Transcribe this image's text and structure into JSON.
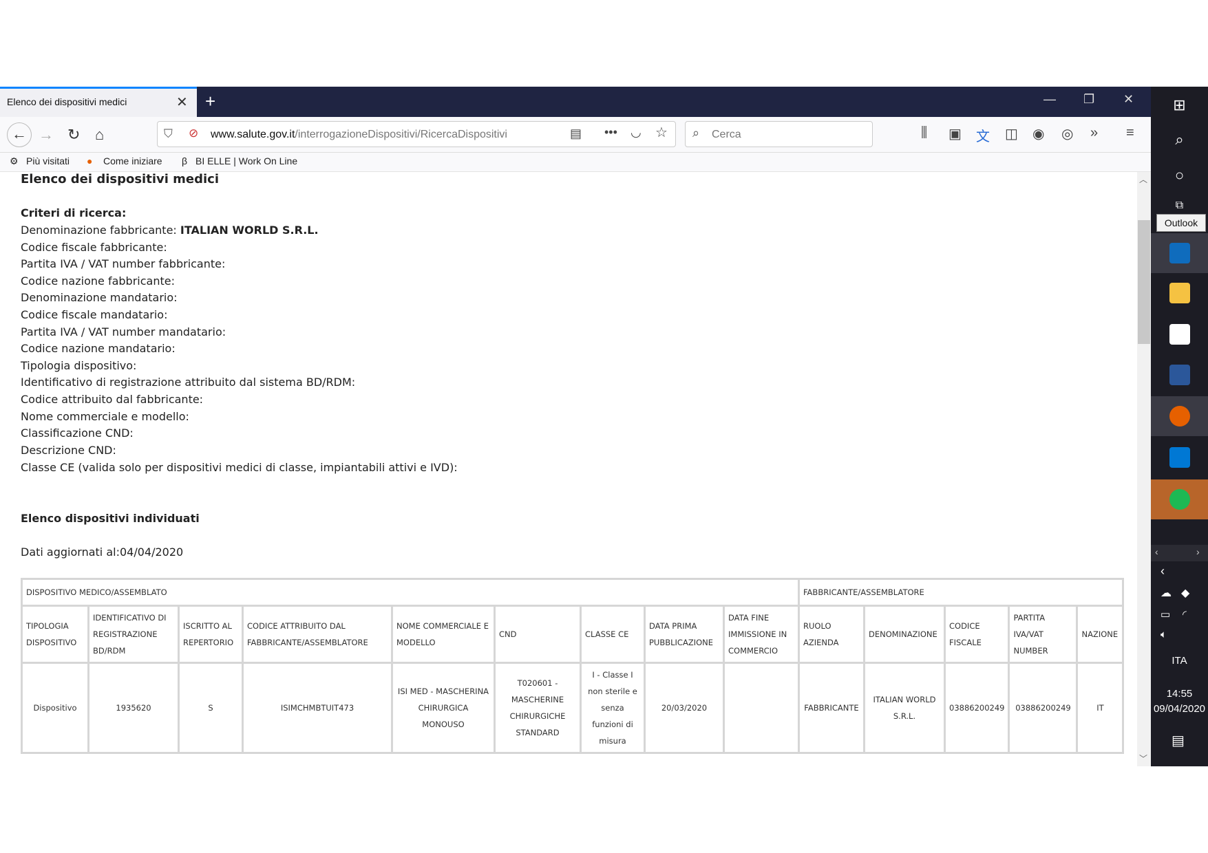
{
  "browser": {
    "tab_title": "Elenco dei dispositivi medici",
    "tab_close": "✕",
    "new_tab": "+",
    "url_domain": "www.salute.gov.it",
    "url_path": "/interrogazioneDispositivi/RicercaDispositivi",
    "search_placeholder": "Cerca",
    "bookmarks": [
      "Più visitati",
      "Come iniziare",
      "BI ELLE | Work On Line"
    ]
  },
  "page": {
    "title": "Elenco dei dispositivi medici",
    "criteria_title": "Criteri di ricerca:",
    "criteria": [
      {
        "label": "Denominazione fabbricante:",
        "value": "ITALIAN WORLD S.R.L."
      },
      {
        "label": "Codice fiscale fabbricante:",
        "value": ""
      },
      {
        "label": "Partita IVA / VAT number fabbricante:",
        "value": ""
      },
      {
        "label": "Codice nazione fabbricante:",
        "value": ""
      },
      {
        "label": "Denominazione mandatario:",
        "value": ""
      },
      {
        "label": "Codice fiscale mandatario:",
        "value": ""
      },
      {
        "label": "Partita IVA / VAT number mandatario:",
        "value": ""
      },
      {
        "label": "Codice nazione mandatario:",
        "value": ""
      },
      {
        "label": "Tipologia dispositivo:",
        "value": ""
      },
      {
        "label": "Identificativo di registrazione attribuito dal sistema BD/RDM:",
        "value": ""
      },
      {
        "label": "Codice attribuito dal fabbricante:",
        "value": ""
      },
      {
        "label": "Nome commerciale e modello:",
        "value": ""
      },
      {
        "label": "Classificazione CND:",
        "value": ""
      },
      {
        "label": "Descrizione CND:",
        "value": ""
      },
      {
        "label": "Classe CE (valida solo per dispositivi medici di classe, impiantabili attivi e IVD):",
        "value": ""
      }
    ],
    "found_title": "Elenco dispositivi individuati",
    "updated": "Dati aggiornati al:04/04/2020"
  },
  "table": {
    "group_headers": [
      "DISPOSITIVO MEDICO/ASSEMBLATO",
      "FABBRICANTE/ASSEMBLATORE"
    ],
    "columns": [
      "TIPOLOGIA DISPOSITIVO",
      "IDENTIFICATIVO DI REGISTRAZIONE BD/RDM",
      "ISCRITTO AL REPERTORIO",
      "CODICE ATTRIBUITO DAL FABBRICANTE/ASSEMBLATORE",
      "NOME COMMERCIALE E MODELLO",
      "CND",
      "CLASSE CE",
      "DATA PRIMA PUBBLICAZIONE",
      "DATA FINE IMMISSIONE IN COMMERCIO",
      "RUOLO AZIENDA",
      "DENOMINAZIONE",
      "CODICE FISCALE",
      "PARTITA IVA/VAT NUMBER",
      "NAZIONE"
    ],
    "rows": [
      [
        "Dispositivo",
        "1935620",
        "S",
        "ISIMCHMBTUIT473",
        "ISI MED - MASCHERINA CHIRURGICA MONOUSO",
        "T020601 - MASCHERINE CHIRURGICHE STANDARD",
        "I - Classe I non sterile e senza funzioni di misura",
        "20/03/2020",
        "",
        "FABBRICANTE",
        "ITALIAN WORLD S.R.L.",
        "03886200249",
        "03886200249",
        "IT"
      ]
    ]
  },
  "taskbar": {
    "tooltip": "Outlook",
    "language": "ITA",
    "time": "14:55",
    "date": "09/04/2020"
  }
}
